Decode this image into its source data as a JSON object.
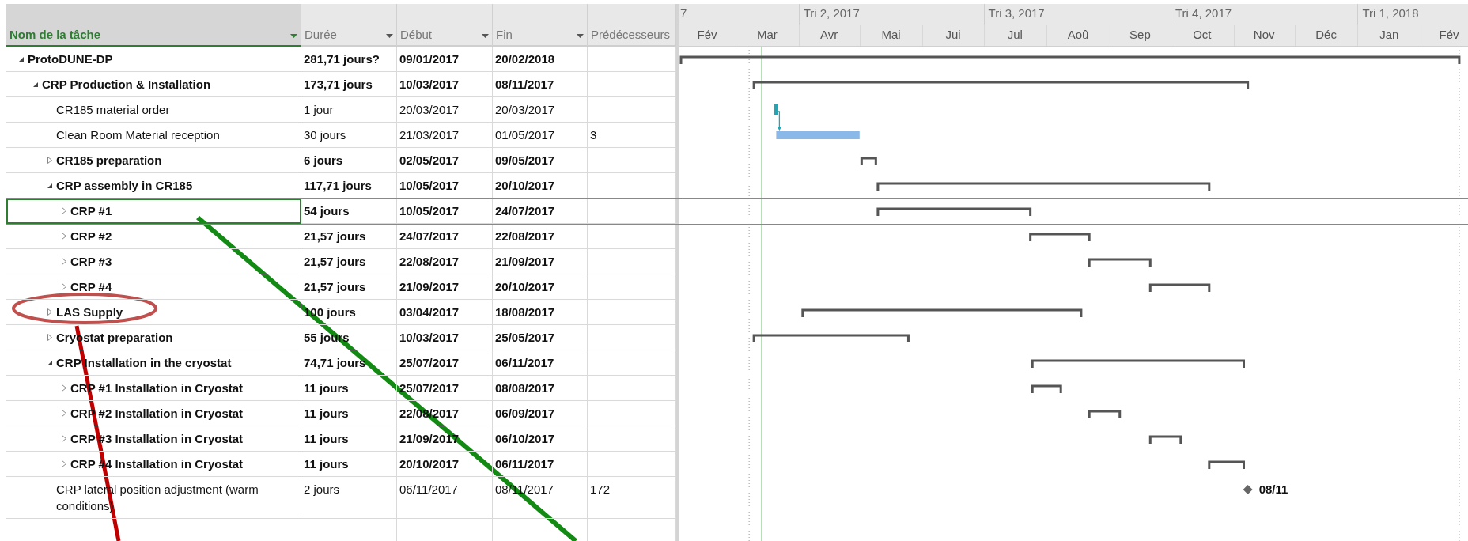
{
  "columns": [
    {
      "label": "Nom de la tâche",
      "selected": true,
      "dropdown": true
    },
    {
      "label": "Durée",
      "selected": false,
      "dropdown": true
    },
    {
      "label": "Début",
      "selected": false,
      "dropdown": true
    },
    {
      "label": "Fin",
      "selected": false,
      "dropdown": true
    },
    {
      "label": "Prédécesseurs",
      "selected": false,
      "dropdown": false
    }
  ],
  "timeline": {
    "quarters": [
      "7",
      "Tri 2, 2017",
      "Tri 3, 2017",
      "Tri 4, 2017",
      "Tri 1, 2018"
    ],
    "months": [
      "Fév",
      "Mar",
      "Avr",
      "Mai",
      "Jui",
      "Jul",
      "Aoû",
      "Sep",
      "Oct",
      "Nov",
      "Déc",
      "Jan",
      "Fév"
    ]
  },
  "tasks": [
    {
      "name": "ProtoDUNE-DP",
      "kind": "summary",
      "expanded": true,
      "selected": false,
      "duration": "281,71 jours?",
      "start": "09/01/2017",
      "finish": "20/02/2018",
      "children": [
        {
          "name": "CRP Production & Installation",
          "kind": "summary",
          "expanded": true,
          "selected": false,
          "duration": "173,71 jours",
          "start": "10/03/2017",
          "finish": "08/11/2017",
          "children": [
            {
              "name": "CR185 material order",
              "kind": "task",
              "color": "#2aa3b0",
              "selected": false,
              "duration": "1 jour",
              "start": "20/03/2017",
              "finish": "20/03/2017"
            },
            {
              "name": "Clean Room Material reception",
              "kind": "task",
              "linked": true,
              "color": "#8ab8e8",
              "selected": false,
              "duration": "30 jours",
              "start": "21/03/2017",
              "finish": "01/05/2017",
              "predecessors": "3"
            },
            {
              "name": "CR185 preparation",
              "kind": "summary",
              "expanded": false,
              "selected": false,
              "duration": "6 jours",
              "start": "02/05/2017",
              "finish": "09/05/2017"
            },
            {
              "name": "CRP assembly in CR185",
              "kind": "summary",
              "expanded": true,
              "selected": false,
              "duration": "117,71 jours",
              "start": "10/05/2017",
              "finish": "20/10/2017",
              "children": [
                {
                  "name": "CRP #1",
                  "kind": "summary",
                  "expanded": false,
                  "selected": true,
                  "duration": "54 jours",
                  "start": "10/05/2017",
                  "finish": "24/07/2017"
                },
                {
                  "name": "CRP #2",
                  "kind": "summary",
                  "expanded": false,
                  "selected": false,
                  "duration": "21,57 jours",
                  "start": "24/07/2017",
                  "finish": "22/08/2017"
                },
                {
                  "name": "CRP #3",
                  "kind": "summary",
                  "expanded": false,
                  "selected": false,
                  "duration": "21,57 jours",
                  "start": "22/08/2017",
                  "finish": "21/09/2017"
                },
                {
                  "name": "CRP #4",
                  "kind": "summary",
                  "expanded": false,
                  "selected": false,
                  "duration": "21,57 jours",
                  "start": "21/09/2017",
                  "finish": "20/10/2017"
                }
              ]
            },
            {
              "name": "LAS Supply",
              "kind": "summary",
              "expanded": false,
              "selected": false,
              "duration": "100 jours",
              "start": "03/04/2017",
              "finish": "18/08/2017"
            },
            {
              "name": "Cryostat preparation",
              "kind": "summary",
              "expanded": false,
              "selected": false,
              "duration": "55 jours",
              "start": "10/03/2017",
              "finish": "25/05/2017"
            },
            {
              "name": "CRP Installation in the cryostat",
              "kind": "summary",
              "expanded": true,
              "selected": false,
              "duration": "74,71 jours",
              "start": "25/07/2017",
              "finish": "06/11/2017",
              "children": [
                {
                  "name": "CRP #1 Installation in Cryostat",
                  "kind": "summary",
                  "expanded": false,
                  "selected": false,
                  "duration": "11 jours",
                  "start": "25/07/2017",
                  "finish": "08/08/2017"
                },
                {
                  "name": "CRP #2 Installation in Cryostat",
                  "kind": "summary",
                  "expanded": false,
                  "selected": false,
                  "duration": "11 jours",
                  "start": "22/08/2017",
                  "finish": "06/09/2017"
                },
                {
                  "name": "CRP #3 Installation in Cryostat",
                  "kind": "summary",
                  "expanded": false,
                  "selected": false,
                  "duration": "11 jours",
                  "start": "21/09/2017",
                  "finish": "06/10/2017"
                },
                {
                  "name": "CRP #4 Installation in Cryostat",
                  "kind": "summary",
                  "expanded": false,
                  "selected": false,
                  "duration": "11 jours",
                  "start": "20/10/2017",
                  "finish": "06/11/2017"
                }
              ]
            },
            {
              "name": "CRP lateral position adjustment (warm conditions)",
              "kind": "milestone",
              "selected": false,
              "duration": "2 jours",
              "start": "06/11/2017",
              "finish": "08/11/2017",
              "predecessors": "172",
              "label": "08/11"
            }
          ]
        }
      ]
    }
  ]
}
